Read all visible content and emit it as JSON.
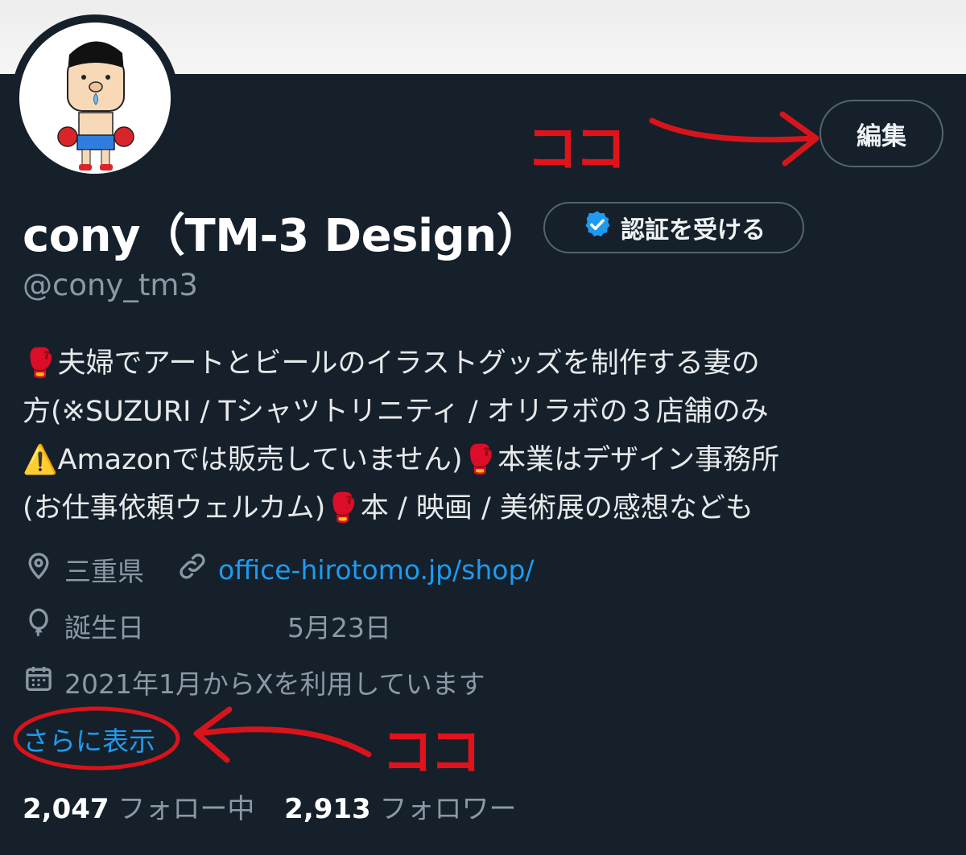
{
  "profile": {
    "name": "cony（TM-3 Design）",
    "handle": "@cony_tm3",
    "edit_label": "編集",
    "verify_label": "認証を受ける",
    "bio_lines": [
      "🥊夫婦でアートとビールのイラストグッズを制作する妻の",
      "方(※SUZURI / Tシャツトリニティ / オリラボの３店舗のみ",
      "⚠️Amazonでは販売していません)🥊本業はデザイン事務所",
      "(お仕事依頼ウェルカム)🥊本 / 映画 / 美術展の感想なども"
    ],
    "location": "三重県",
    "website": "office-hirotomo.jp/shop/",
    "birthday_label": "誕生日",
    "birthday_value": "5月23日",
    "joined": "2021年1月からXを利用しています",
    "show_more": "さらに表示",
    "following_count": "2,047",
    "following_label": "フォロー中",
    "followers_count": "2,913",
    "followers_label": "フォロワー"
  },
  "annotations": {
    "top_label": "ココ",
    "bottom_label": "ココ"
  },
  "icons": [
    "location-icon",
    "link-icon",
    "balloon-icon",
    "calendar-icon",
    "verified-badge-icon"
  ],
  "colors": {
    "background": "#15202b",
    "link": "#1d9bf0",
    "muted": "#8b98a5",
    "annotation": "#e0131b"
  }
}
